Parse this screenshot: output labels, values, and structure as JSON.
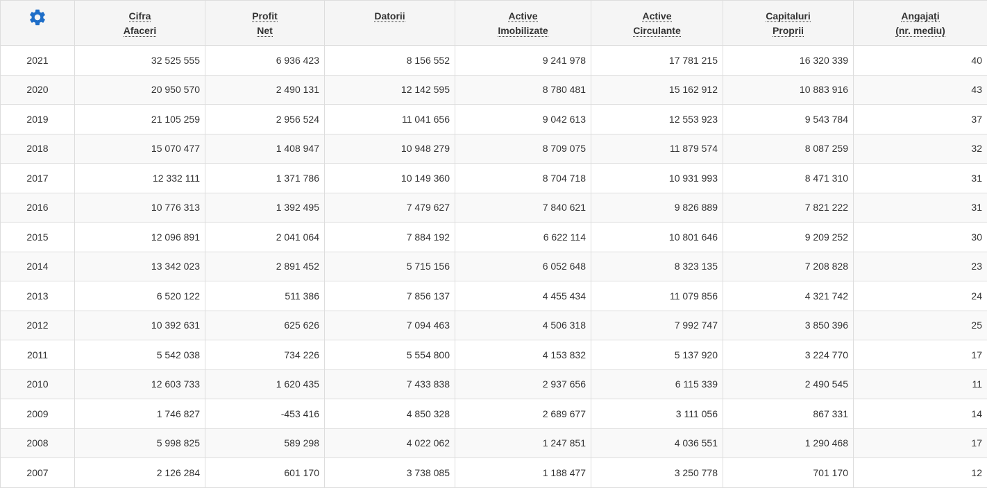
{
  "colors": {
    "gear_icon": "#1e6ec8",
    "header_bg": "#f5f5f5",
    "row_alt_bg": "#f9f9f9",
    "border": "#dddddd",
    "text": "#333333"
  },
  "header": {
    "settings_icon": "gear-icon",
    "columns": [
      {
        "line1": "Cifra",
        "line2": "Afaceri"
      },
      {
        "line1": "Profit",
        "line2": "Net"
      },
      {
        "line1": "Datorii",
        "line2": ""
      },
      {
        "line1": "Active",
        "line2": "Imobilizate"
      },
      {
        "line1": "Active",
        "line2": "Circulante"
      },
      {
        "line1": "Capitaluri",
        "line2": "Proprii"
      },
      {
        "line1": "Angajați",
        "line2": "(nr. mediu)"
      }
    ]
  },
  "rows": [
    {
      "year": "2021",
      "cells": [
        "32 525 555",
        "6 936 423",
        "8 156 552",
        "9 241 978",
        "17 781 215",
        "16 320 339",
        "40"
      ]
    },
    {
      "year": "2020",
      "cells": [
        "20 950 570",
        "2 490 131",
        "12 142 595",
        "8 780 481",
        "15 162 912",
        "10 883 916",
        "43"
      ]
    },
    {
      "year": "2019",
      "cells": [
        "21 105 259",
        "2 956 524",
        "11 041 656",
        "9 042 613",
        "12 553 923",
        "9 543 784",
        "37"
      ]
    },
    {
      "year": "2018",
      "cells": [
        "15 070 477",
        "1 408 947",
        "10 948 279",
        "8 709 075",
        "11 879 574",
        "8 087 259",
        "32"
      ]
    },
    {
      "year": "2017",
      "cells": [
        "12 332 111",
        "1 371 786",
        "10 149 360",
        "8 704 718",
        "10 931 993",
        "8 471 310",
        "31"
      ]
    },
    {
      "year": "2016",
      "cells": [
        "10 776 313",
        "1 392 495",
        "7 479 627",
        "7 840 621",
        "9 826 889",
        "7 821 222",
        "31"
      ]
    },
    {
      "year": "2015",
      "cells": [
        "12 096 891",
        "2 041 064",
        "7 884 192",
        "6 622 114",
        "10 801 646",
        "9 209 252",
        "30"
      ]
    },
    {
      "year": "2014",
      "cells": [
        "13 342 023",
        "2 891 452",
        "5 715 156",
        "6 052 648",
        "8 323 135",
        "7 208 828",
        "23"
      ]
    },
    {
      "year": "2013",
      "cells": [
        "6 520 122",
        "511 386",
        "7 856 137",
        "4 455 434",
        "11 079 856",
        "4 321 742",
        "24"
      ]
    },
    {
      "year": "2012",
      "cells": [
        "10 392 631",
        "625 626",
        "7 094 463",
        "4 506 318",
        "7 992 747",
        "3 850 396",
        "25"
      ]
    },
    {
      "year": "2011",
      "cells": [
        "5 542 038",
        "734 226",
        "5 554 800",
        "4 153 832",
        "5 137 920",
        "3 224 770",
        "17"
      ]
    },
    {
      "year": "2010",
      "cells": [
        "12 603 733",
        "1 620 435",
        "7 433 838",
        "2 937 656",
        "6 115 339",
        "2 490 545",
        "11"
      ]
    },
    {
      "year": "2009",
      "cells": [
        "1 746 827",
        "-453 416",
        "4 850 328",
        "2 689 677",
        "3 111 056",
        "867 331",
        "14"
      ]
    },
    {
      "year": "2008",
      "cells": [
        "5 998 825",
        "589 298",
        "4 022 062",
        "1 247 851",
        "4 036 551",
        "1 290 468",
        "17"
      ]
    },
    {
      "year": "2007",
      "cells": [
        "2 126 284",
        "601 170",
        "3 738 085",
        "1 188 477",
        "3 250 778",
        "701 170",
        "12"
      ]
    }
  ]
}
